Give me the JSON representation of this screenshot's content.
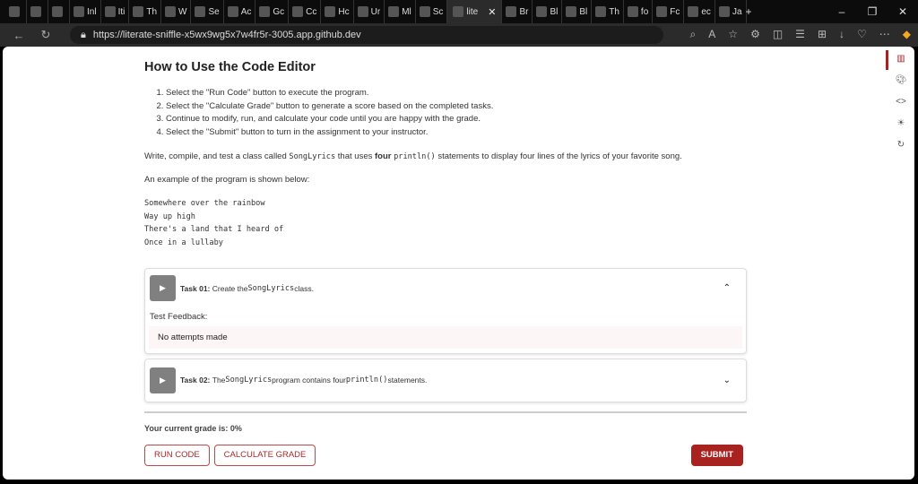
{
  "browser": {
    "tabs": [
      "",
      "",
      "",
      "Inl",
      "Iti",
      "Th",
      "W",
      "Se",
      "Ac",
      "Gc",
      "Cc",
      "Hc",
      "Ur",
      "Ml",
      "Sc",
      "lite",
      "Br",
      "Bl",
      "Bl",
      "Th",
      "fo",
      "Fc",
      "ec",
      "Ja"
    ],
    "active_tab_index": 15,
    "url": "https://literate-sniffle-x5wx9wg5x7w4fr5r-3005.app.github.dev"
  },
  "page": {
    "title": "How to Use the Code Editor",
    "steps": [
      "Select the \"Run Code\" button to execute the program.",
      "Select the \"Calculate Grade\" button to generate a score based on the completed tasks.",
      "Continue to modify, run, and calculate your code until you are happy with the grade.",
      "Select the \"Submit\" button to turn in the assignment to your instructor."
    ],
    "desc": {
      "a": "Write, compile, and test a class called ",
      "class_name": "SongLyrics",
      "b": " that uses ",
      "bold": "four",
      "method": "println()",
      "c": " statements to display four lines of the lyrics of your favorite song."
    },
    "example_intro": "An example of the program is shown below:",
    "example_code": "Somewhere over the rainbow\nWay up high\nThere's a land that I heard of\nOnce in a lullaby",
    "tasks": [
      {
        "label": "Task 01:",
        "a": "Create the ",
        "code": "SongLyrics",
        "b": " class.",
        "feedback_label": "Test Feedback:",
        "feedback": "No attempts made",
        "expanded": true
      },
      {
        "label": "Task 02:",
        "a": "The ",
        "code": "SongLyrics",
        "b": " program contains four ",
        "code2": "println()",
        "c": " statements.",
        "expanded": false
      }
    ],
    "grade_text": "Your current grade is: 0%",
    "buttons": {
      "run": "RUN CODE",
      "calc": "CALCULATE GRADE",
      "submit": "SUBMIT"
    },
    "accent": "#a8221f"
  }
}
